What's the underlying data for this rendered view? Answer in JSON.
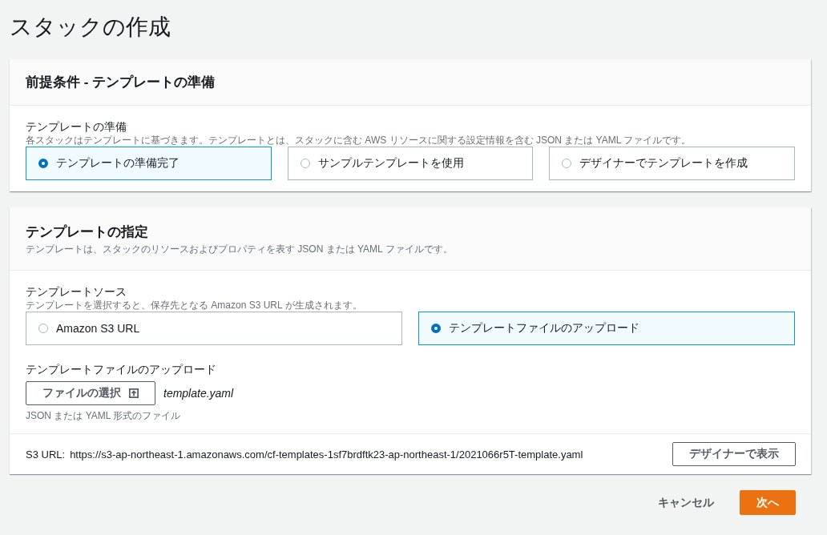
{
  "page_title": "スタックの作成",
  "prerequisite": {
    "title": "前提条件 - テンプレートの準備",
    "field_label": "テンプレートの準備",
    "field_description": "各スタックはテンプレートに基づきます。テンプレートとは、スタックに含む AWS リソースに関する設定情報を含む JSON または YAML ファイルです。",
    "options": [
      {
        "label": "テンプレートの準備完了",
        "selected": true
      },
      {
        "label": "サンプルテンプレートを使用",
        "selected": false
      },
      {
        "label": "デザイナーでテンプレートを作成",
        "selected": false
      }
    ]
  },
  "specify": {
    "title": "テンプレートの指定",
    "description": "テンプレートは、スタックのリソースおよびプロパティを表す JSON または YAML ファイルです。",
    "source_label": "テンプレートソース",
    "source_description": "テンプレートを選択すると、保存先となる Amazon S3 URL が生成されます。",
    "sources": [
      {
        "label": "Amazon S3 URL",
        "selected": false
      },
      {
        "label": "テンプレートファイルのアップロード",
        "selected": true
      }
    ],
    "upload_label": "テンプレートファイルのアップロード",
    "choose_file_button": "ファイルの選択",
    "file_name": "template.yaml",
    "upload_hint": "JSON または YAML 形式のファイル",
    "s3_url_label": "S3 URL:",
    "s3_url": "https://s3-ap-northeast-1.amazonaws.com/cf-templates-1sf7brdftk23-ap-northeast-1/2021066r5T-template.yaml",
    "view_in_designer_button": "デザイナーで表示"
  },
  "buttons": {
    "cancel": "キャンセル",
    "next": "次へ"
  }
}
